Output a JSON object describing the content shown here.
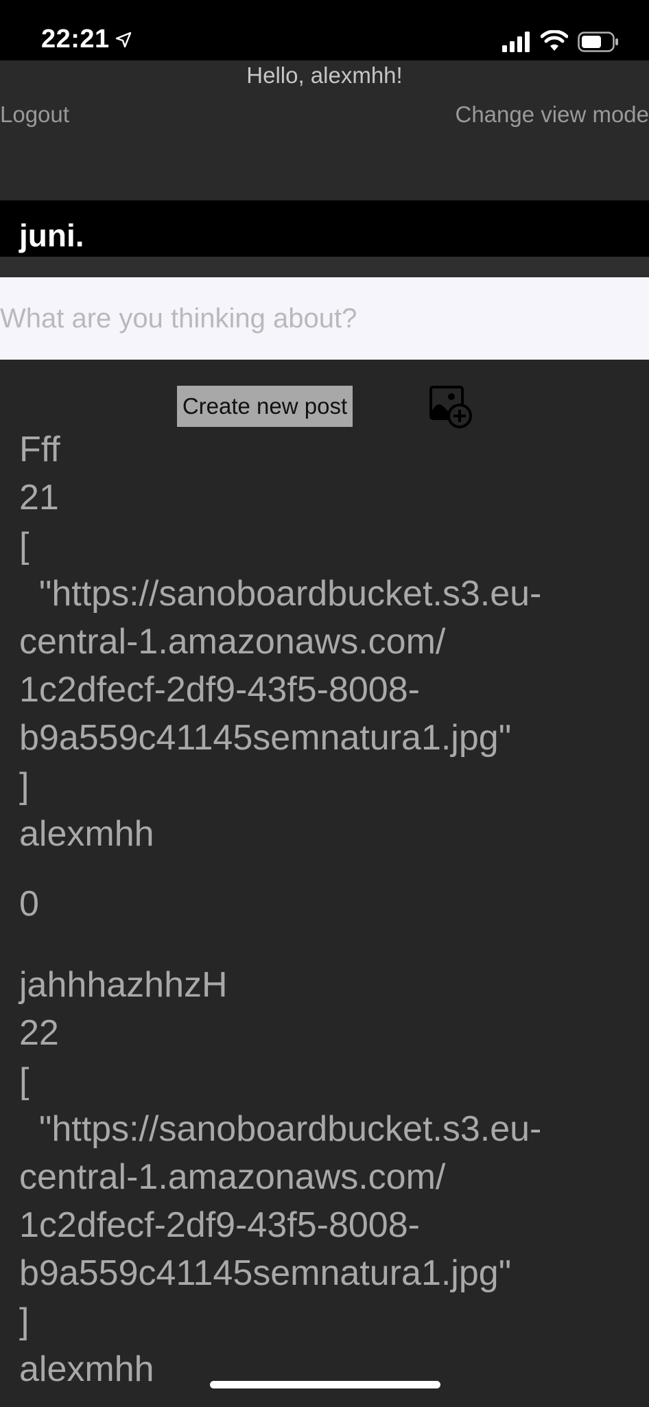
{
  "status_bar": {
    "time": "22:21"
  },
  "header": {
    "greeting": "Hello, alexmhh!",
    "logout_label": "Logout",
    "view_mode_label": "Change view mode"
  },
  "month": {
    "label": "juni."
  },
  "composer": {
    "placeholder": "What are you thinking about?",
    "create_label": "Create new post"
  },
  "posts": [
    {
      "title": "Fff",
      "number": "21",
      "images_open": "[",
      "image_url_1": "  \"https://sanoboardbucket.s3.eu-",
      "image_url_2": "central-1.amazonaws.com/",
      "image_url_3": "1c2dfecf-2df9-43f5-8008-",
      "image_url_4": "b9a559c41145semnatura1.jpg\"",
      "images_close": "]",
      "author": "alexmhh",
      "likes": "0"
    },
    {
      "title": "jahhhazhhzH",
      "number": "22",
      "images_open": "[",
      "image_url_1": "  \"https://sanoboardbucket.s3.eu-",
      "image_url_2": "central-1.amazonaws.com/",
      "image_url_3": "1c2dfecf-2df9-43f5-8008-",
      "image_url_4": "b9a559c41145semnatura1.jpg\"",
      "images_close": "]",
      "author": "alexmhh"
    }
  ],
  "colors": {
    "background": "#262626",
    "header": "#2a2a2a",
    "band": "#000000",
    "input_bg": "#f5f5fb",
    "button_bg": "#a8a8a8",
    "text": "#a9a9a9"
  },
  "icons": {
    "location": "location-arrow-icon",
    "signal": "cellular-signal-icon",
    "wifi": "wifi-icon",
    "battery": "battery-icon",
    "add_image": "add-image-icon"
  }
}
